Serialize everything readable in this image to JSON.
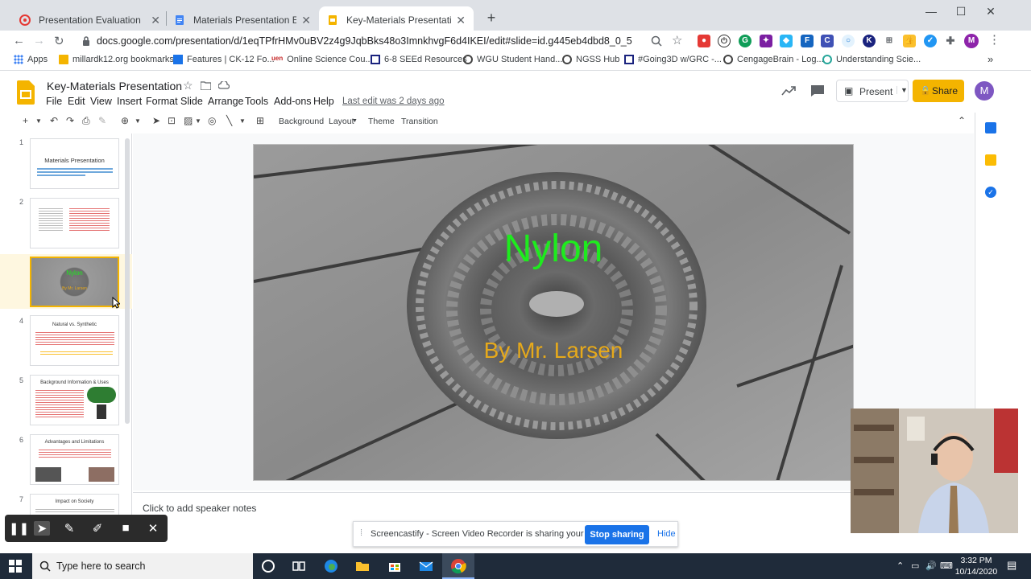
{
  "browser": {
    "tabs": [
      {
        "label": "Presentation Evaluation",
        "icon": "target-icon",
        "active": false
      },
      {
        "label": "Materials Presentation Evaluation",
        "icon": "docs-icon",
        "active": false
      },
      {
        "label": "Key-Materials Presentation - Goo",
        "icon": "slides-icon",
        "active": true
      }
    ],
    "new_tab_symbol": "+",
    "url": "docs.google.com/presentation/d/1eqTPfrHMv0uBV2z4g9JqbBks48o3ImnkhvgF6d4IKEI/edit#slide=id.g445eb4dbd8_0_5",
    "profile_initial": "M"
  },
  "bookmarks": [
    {
      "label": "Apps"
    },
    {
      "label": "millardk12.org bookmarks"
    },
    {
      "label": "Features | CK-12 Fo..."
    },
    {
      "label": "Online Science Cou..."
    },
    {
      "label": "6-8 SEEd Resources"
    },
    {
      "label": "WGU Student Hand..."
    },
    {
      "label": "NGSS Hub"
    },
    {
      "label": "#Going3D w/GRC -..."
    },
    {
      "label": "CengageBrain - Log..."
    },
    {
      "label": "Understanding Scie..."
    }
  ],
  "doc": {
    "title": "Key-Materials Presentation",
    "last_edit": "Last edit was 2 days ago",
    "menus": [
      "File",
      "Edit",
      "View",
      "Insert",
      "Format",
      "Slide",
      "Arrange",
      "Tools",
      "Add-ons",
      "Help"
    ],
    "present_label": "Present",
    "share_label": "Share",
    "user_initial": "M"
  },
  "toolbar": {
    "background_label": "Background",
    "layout_label": "Layout",
    "theme_label": "Theme",
    "transition_label": "Transition"
  },
  "filmstrip": {
    "slides": [
      {
        "number": "1",
        "title": "Materials Presentation"
      },
      {
        "number": "2",
        "title": ""
      },
      {
        "number": "3",
        "title": ""
      },
      {
        "number": "4",
        "title": "Natural vs. Synthetic"
      },
      {
        "number": "5",
        "title": "Background Information & Uses"
      },
      {
        "number": "6",
        "title": "Advantages and Limitations"
      },
      {
        "number": "7",
        "title": "Impact on Society"
      }
    ],
    "selected": 3
  },
  "slide": {
    "title": "Nylon",
    "subtitle": "By Mr. Larsen",
    "title_color": "#1eeb1e",
    "subtitle_color": "#e6a91b"
  },
  "notes_placeholder": "Click to add speaker notes",
  "screencastify": {
    "message": "Screencastify - Screen Video Recorder is sharing your screen.",
    "stop_label": "Stop sharing",
    "hide_label": "Hide"
  },
  "taskbar": {
    "search_placeholder": "Type here to search",
    "time": "3:32 PM",
    "date": "10/14/2020"
  }
}
